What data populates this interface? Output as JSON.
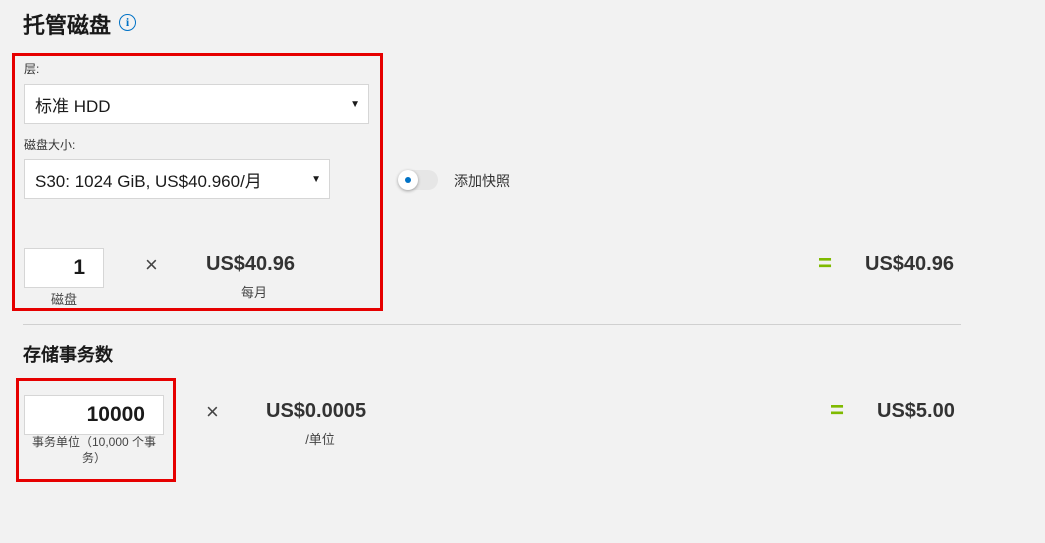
{
  "managed_disks": {
    "title": "托管磁盘",
    "info_icon": "i",
    "tier_label": "层:",
    "tier_value": "标准 HDD",
    "size_label": "磁盘大小:",
    "size_value": "S30: 1024 GiB, US$40.960/月",
    "snapshot_label": "添加快照",
    "snapshot_enabled": false,
    "quantity": "1",
    "quantity_unit": "磁盘",
    "times": "×",
    "unit_price": "US$40.96",
    "unit_price_period": "每月",
    "equals": "=",
    "total": "US$40.96"
  },
  "storage_transactions": {
    "title": "存储事务数",
    "quantity": "10000",
    "quantity_unit": "事务单位（10,000 个事务）",
    "times": "×",
    "unit_price": "US$0.0005",
    "unit_price_period": "/单位",
    "equals": "=",
    "total": "US$5.00"
  },
  "colors": {
    "accent_blue": "#0072c6",
    "highlight_red": "#e60000",
    "equals_green": "#7fba00"
  }
}
